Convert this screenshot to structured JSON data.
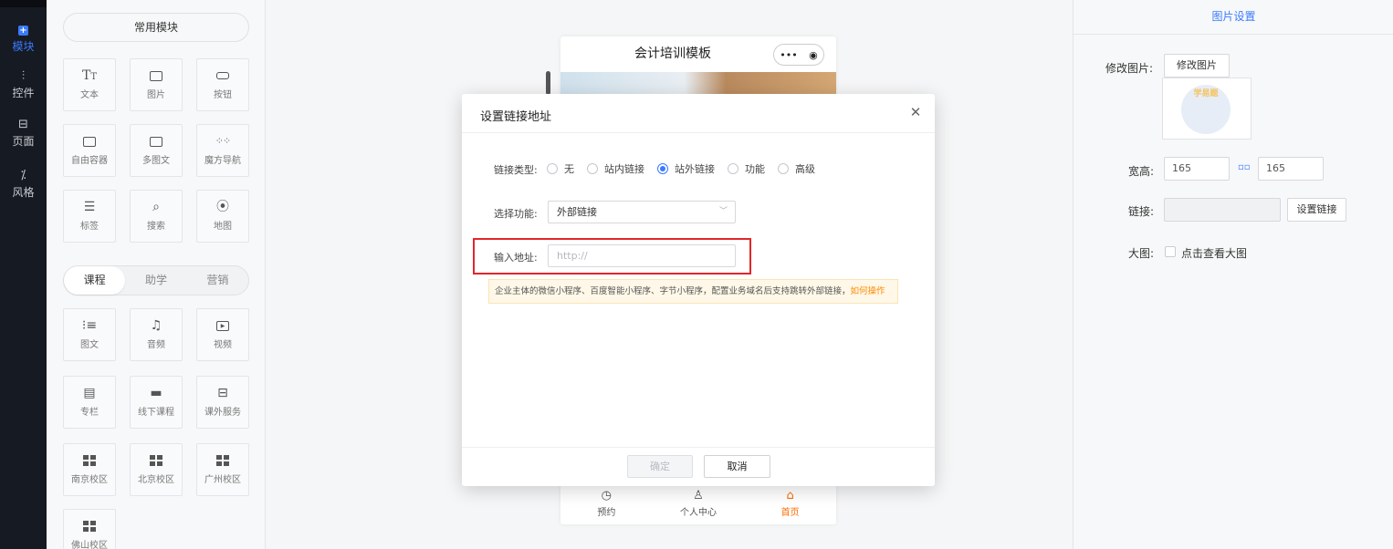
{
  "nav": {
    "items": [
      {
        "label": "模块",
        "icon": "plus-square-icon"
      },
      {
        "label": "控件",
        "icon": "sliders-icon"
      },
      {
        "label": "页面",
        "icon": "pages-icon"
      },
      {
        "label": "风格",
        "icon": "magic-wand-icon"
      }
    ]
  },
  "modules": {
    "common_label": "常用模块",
    "common": [
      {
        "label": "文本",
        "icon": "text-icon",
        "glyph": "Tт"
      },
      {
        "label": "图片",
        "icon": "image-icon",
        "glyph": ""
      },
      {
        "label": "按钮",
        "icon": "button-icon",
        "glyph": ""
      },
      {
        "label": "自由容器",
        "icon": "container-icon",
        "glyph": ""
      },
      {
        "label": "多图文",
        "icon": "multi-image-icon",
        "glyph": ""
      },
      {
        "label": "魔方导航",
        "icon": "dots-grid-icon",
        "glyph": "⋮⋮⋮"
      },
      {
        "label": "标签",
        "icon": "tag-icon",
        "glyph": "☰"
      },
      {
        "label": "搜索",
        "icon": "search-icon",
        "glyph": "⌕"
      },
      {
        "label": "地图",
        "icon": "map-pin-icon",
        "glyph": "⦿"
      }
    ],
    "tabs": [
      "课程",
      "助学",
      "营销"
    ],
    "course": [
      {
        "label": "图文",
        "icon": "article-icon",
        "glyph": "⁝≡"
      },
      {
        "label": "音频",
        "icon": "audio-icon",
        "glyph": "♫"
      },
      {
        "label": "视频",
        "icon": "video-icon",
        "glyph": "▶"
      },
      {
        "label": "专栏",
        "icon": "column-icon",
        "glyph": "▤"
      },
      {
        "label": "线下课程",
        "icon": "offline-course-icon",
        "glyph": "▭"
      },
      {
        "label": "课外服务",
        "icon": "briefcase-icon",
        "glyph": "⊟"
      },
      {
        "label": "南京校区",
        "icon": "campus-grid-icon",
        "glyph": ""
      },
      {
        "label": "北京校区",
        "icon": "campus-grid-icon",
        "glyph": ""
      },
      {
        "label": "广州校区",
        "icon": "campus-grid-icon",
        "glyph": ""
      },
      {
        "label": "佛山校区",
        "icon": "campus-grid-icon",
        "glyph": ""
      }
    ]
  },
  "phone": {
    "title": "会计培训模板",
    "capsule_more": "•••",
    "capsule_target": "◉",
    "tabbar": [
      {
        "label": "预约",
        "glyph": "◷",
        "icon": "clock-icon"
      },
      {
        "label": "个人中心",
        "glyph": "♙",
        "icon": "user-icon"
      },
      {
        "label": "首页",
        "glyph": "⌂",
        "icon": "home-icon"
      }
    ]
  },
  "settings": {
    "title": "图片设置",
    "modify_label": "修改图片:",
    "modify_button": "修改图片",
    "size_label": "宽高:",
    "width": "165",
    "height": "165",
    "link_icon": "▫▫",
    "link_label": "链接:",
    "link_value": "",
    "set_link_button": "设置链接",
    "bigimg_label": "大图:",
    "bigimg_text": "点击查看大图",
    "thumb_text": "学易题"
  },
  "modal": {
    "title": "设置链接地址",
    "close": "✕",
    "link_type_label": "链接类型:",
    "link_types": [
      {
        "label": "无",
        "selected": false
      },
      {
        "label": "站内链接",
        "selected": false
      },
      {
        "label": "站外链接",
        "selected": true
      },
      {
        "label": "功能",
        "selected": false
      },
      {
        "label": "高级",
        "selected": false
      }
    ],
    "function_label": "选择功能:",
    "function_value": "外部链接",
    "url_label": "输入地址:",
    "url_placeholder": "http://",
    "url_value": "",
    "tip": "企业主体的微信小程序、百度智能小程序、字节小程序，配置业务域名后支持跳转外部链接，",
    "tip_link": "如何操作",
    "ok": "确定",
    "cancel": "取消"
  }
}
